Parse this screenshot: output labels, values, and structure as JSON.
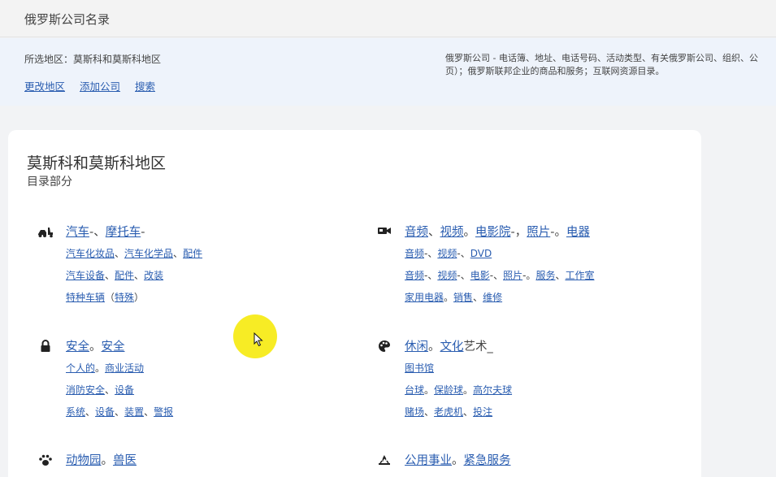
{
  "header": {
    "title": "俄罗斯公司名录"
  },
  "info": {
    "region_text": "所选地区：莫斯科和莫斯科地区",
    "links": [
      "更改地区",
      "添加公司",
      "搜索"
    ],
    "description_line1": "俄罗斯公司 - 电话簿、地址、电话号码、活动类型、有关俄罗斯公司、组织、公",
    "description_line2": "页）；俄罗斯联邦企业的商品和服务；互联网资源目录。"
  },
  "catalog": {
    "title": "莫斯科和莫斯科地区",
    "subtitle": "目录部分",
    "categories": [
      {
        "icon": "car-scooter-icon",
        "title": [
          {
            "t": "汽车",
            "link": true
          },
          {
            "t": "-、",
            "link": false
          },
          {
            "t": "摩托车",
            "link": true
          },
          {
            "t": "-",
            "link": false
          }
        ],
        "subs": [
          [
            {
              "t": "汽车化妆品",
              "link": true
            },
            {
              "t": "、",
              "link": false
            },
            {
              "t": "汽车化学品",
              "link": true
            },
            {
              "t": "、",
              "link": false
            },
            {
              "t": "配件",
              "link": true
            }
          ],
          [
            {
              "t": "汽车设备",
              "link": true
            },
            {
              "t": "、",
              "link": false
            },
            {
              "t": "配件",
              "link": true
            },
            {
              "t": "、",
              "link": false
            },
            {
              "t": "改装",
              "link": true
            }
          ],
          [
            {
              "t": "特种车辆",
              "link": true
            },
            {
              "t": "（",
              "link": false
            },
            {
              "t": "特殊",
              "link": true
            },
            {
              "t": "）",
              "link": false
            }
          ]
        ]
      },
      {
        "icon": "video-camera-icon",
        "title": [
          {
            "t": "音频",
            "link": true
          },
          {
            "t": "、",
            "link": false
          },
          {
            "t": "视频",
            "link": true
          },
          {
            "t": "。",
            "link": false
          },
          {
            "t": "电影院",
            "link": true
          },
          {
            "t": "-，",
            "link": false
          },
          {
            "t": "照片",
            "link": true
          },
          {
            "t": "-。",
            "link": false
          },
          {
            "t": "电器",
            "link": true
          }
        ],
        "subs": [
          [
            {
              "t": "音频",
              "link": true
            },
            {
              "t": "-、",
              "link": false
            },
            {
              "t": "视频",
              "link": true
            },
            {
              "t": "-、",
              "link": false
            },
            {
              "t": "DVD",
              "link": true
            }
          ],
          [
            {
              "t": "音频",
              "link": true
            },
            {
              "t": "-、",
              "link": false
            },
            {
              "t": "视频",
              "link": true
            },
            {
              "t": "-、",
              "link": false
            },
            {
              "t": "电影",
              "link": true
            },
            {
              "t": "-、",
              "link": false
            },
            {
              "t": "照片",
              "link": true
            },
            {
              "t": "-。",
              "link": false
            },
            {
              "t": "服务",
              "link": true
            },
            {
              "t": "、",
              "link": false
            },
            {
              "t": "工作室",
              "link": true
            }
          ],
          [
            {
              "t": "家用电器",
              "link": true
            },
            {
              "t": "。",
              "link": false
            },
            {
              "t": "销售",
              "link": true
            },
            {
              "t": "、",
              "link": false
            },
            {
              "t": "维修",
              "link": true
            }
          ]
        ]
      },
      {
        "icon": "lock-icon",
        "title": [
          {
            "t": "安全",
            "link": true
          },
          {
            "t": "。",
            "link": false
          },
          {
            "t": "安全",
            "link": true
          }
        ],
        "subs": [
          [
            {
              "t": "个人的",
              "link": true
            },
            {
              "t": "。",
              "link": false
            },
            {
              "t": "商业活动",
              "link": true
            }
          ],
          [
            {
              "t": "消防安全",
              "link": true
            },
            {
              "t": "、",
              "link": false
            },
            {
              "t": "设备",
              "link": true
            }
          ],
          [
            {
              "t": "系统",
              "link": true
            },
            {
              "t": "、",
              "link": false
            },
            {
              "t": "设备",
              "link": true
            },
            {
              "t": "、",
              "link": false
            },
            {
              "t": "装置",
              "link": true
            },
            {
              "t": "、",
              "link": false
            },
            {
              "t": "警报",
              "link": true
            }
          ]
        ]
      },
      {
        "icon": "palette-icon",
        "title": [
          {
            "t": "休闲",
            "link": true
          },
          {
            "t": "。",
            "link": false
          },
          {
            "t": "文化",
            "link": true
          },
          {
            "t": "艺术_",
            "link": false
          }
        ],
        "subs": [
          [
            {
              "t": "图书馆",
              "link": true
            }
          ],
          [
            {
              "t": "台球",
              "link": true
            },
            {
              "t": "。",
              "link": false
            },
            {
              "t": "保龄球",
              "link": true
            },
            {
              "t": "。",
              "link": false
            },
            {
              "t": "高尔夫球",
              "link": true
            }
          ],
          [
            {
              "t": "赌场",
              "link": true
            },
            {
              "t": "、",
              "link": false
            },
            {
              "t": "老虎机",
              "link": true
            },
            {
              "t": "、",
              "link": false
            },
            {
              "t": "投注",
              "link": true
            }
          ]
        ]
      },
      {
        "icon": "paw-icon",
        "title": [
          {
            "t": "动物园",
            "link": true
          },
          {
            "t": "。",
            "link": false
          },
          {
            "t": "兽医",
            "link": true
          }
        ],
        "subs": []
      },
      {
        "icon": "fire-service-icon",
        "title": [
          {
            "t": "公用事业",
            "link": true
          },
          {
            "t": "。",
            "link": false
          },
          {
            "t": "紧急服务",
            "link": true
          }
        ],
        "subs": []
      }
    ]
  },
  "colors": {
    "link": "#2a5db0",
    "highlight": "#f7ec25",
    "info_bg": "#eef3fb"
  }
}
